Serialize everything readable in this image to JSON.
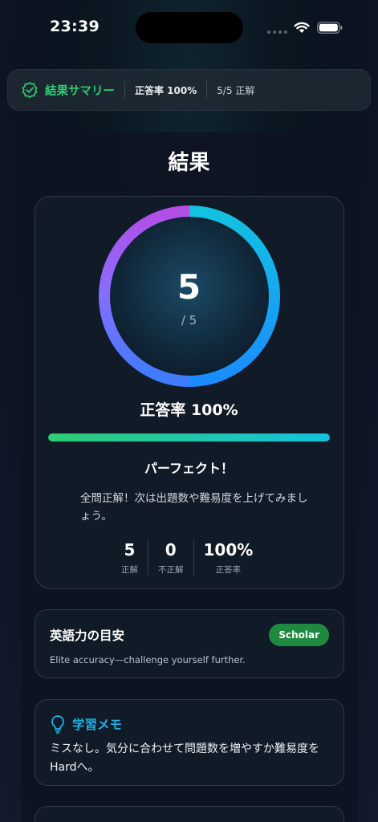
{
  "status_bar": {
    "time": "23:39"
  },
  "summary": {
    "title": "結果サマリー",
    "rate": "正答率 100%",
    "count": "5/5 正解",
    "accent": "#2ecc71"
  },
  "page": {
    "title": "結果"
  },
  "score": {
    "correct": "5",
    "total_label": "/ 5",
    "rate_text": "正答率 100%",
    "progress": 1.0
  },
  "feedback": {
    "title": "パーフェクト！",
    "description": "全問正解！次は出題数や難易度を上げてみましょう。"
  },
  "stats": [
    {
      "value": "5",
      "label": "正解"
    },
    {
      "value": "0",
      "label": "不正解"
    },
    {
      "value": "100%",
      "label": "正答率"
    }
  ],
  "level": {
    "title": "英語力の目安",
    "badge": "Scholar",
    "badge_color": "#1f8a3f",
    "description": "Elite accuracy—challenge yourself further."
  },
  "memo": {
    "icon": "lightbulb-icon",
    "title": "学習メモ",
    "text": "ミスなし。気分に合わせて問題数を増やすか難易度をHardへ。"
  },
  "icons": [
    "check-badge-icon",
    "wifi-icon",
    "battery-icon",
    "lightbulb-icon"
  ]
}
